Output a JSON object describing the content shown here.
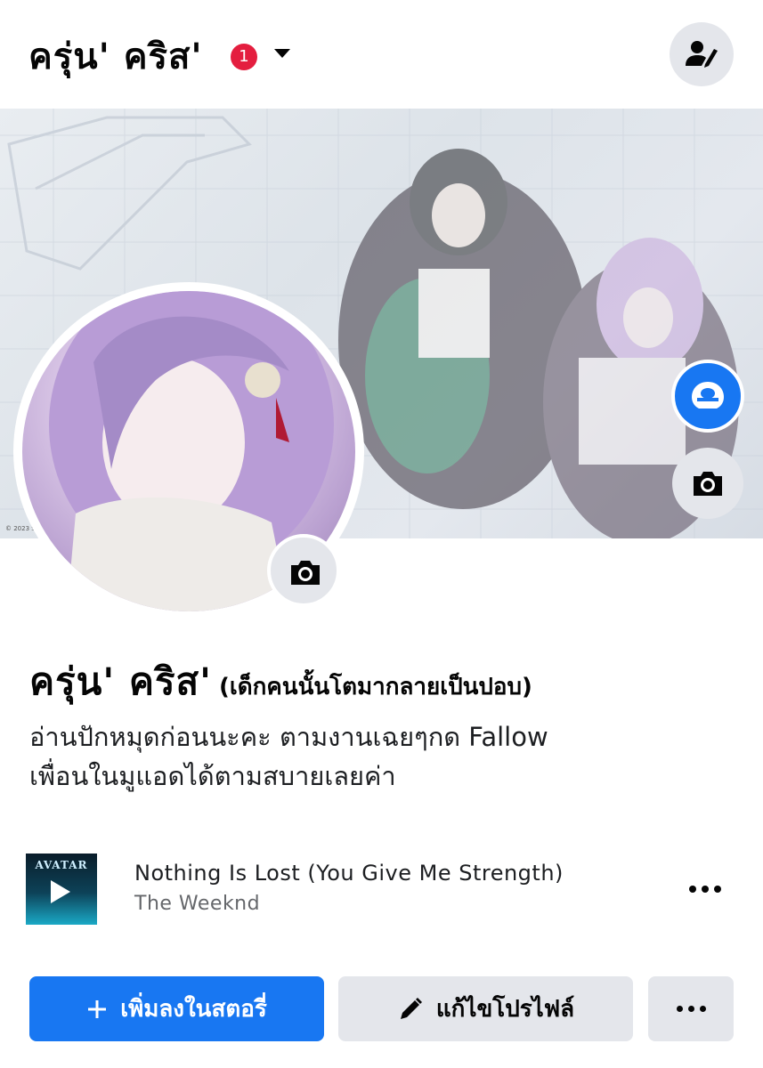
{
  "header": {
    "profile_name": "ครุ่น' คริส'",
    "notification_count": "1",
    "caret_icon": "chevron-down-icon",
    "action_icon": "edit-profile-person-icon"
  },
  "cover": {
    "copyright": "© 2023 SU...",
    "messenger_icon": "messenger-a-icon",
    "camera_icon": "camera-icon"
  },
  "avatar": {
    "camera_icon": "camera-icon"
  },
  "profile": {
    "name": "ครุ่น' คริส'",
    "alternate_name": "(เด็กคนนั้นโตมากลายเป็นปอบ)",
    "bio_line1": "อ่านปักหมุดก่อนนะคะ ตามงานเฉยๆกด Fallow",
    "bio_line2": "เพื่อนในมูแอดได้ตามสบายเลยค่า"
  },
  "music": {
    "album_label": "AVATAR",
    "song_title": "Nothing Is Lost (You Give Me Strength)",
    "artist": "The Weeknd"
  },
  "buttons": {
    "add_story": "เพิ่มลงในสตอรี่",
    "edit_profile": "แก้ไขโปรไฟล์"
  },
  "colors": {
    "primary": "#1877f2",
    "button_gray": "#e4e6eb",
    "badge_red": "#e41e3f",
    "secondary_text": "#65676b"
  }
}
